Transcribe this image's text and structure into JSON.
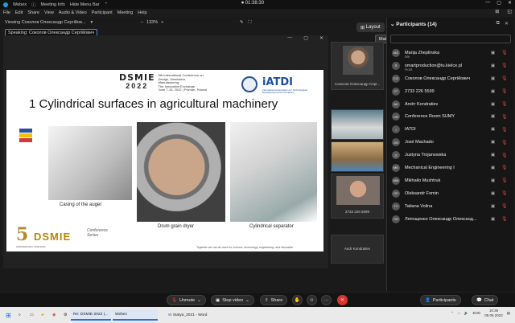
{
  "titlebar": {
    "app": "Webex",
    "meeting_info": "Meeting Info",
    "hide_menu": "Hide Menu Bar",
    "hide_arrow": "⌃",
    "timer": "01:38:30",
    "minimize": "—",
    "restore": "▢",
    "close": "✕"
  },
  "menu": [
    "File",
    "Edit",
    "Share",
    "View",
    "Audio & Video",
    "Participant",
    "Meeting",
    "Help"
  ],
  "viewbar": {
    "viewing": "Viewing Соколов Олександр Сергійов...",
    "zoom_minus": "–",
    "zoom": "133%",
    "zoom_plus": "+"
  },
  "speaking": "Speaking: Соколов Олександр Сергійович",
  "slide": {
    "dsmie": "DSMIE",
    "year": "2022",
    "conf_lines": [
      "5th International Conference on",
      "Design, Simulation, Manufacturing:",
      "The Innovation Exchange",
      "June 7-10, 2022 | Poznan, Poland"
    ],
    "iatdi": "iATDI",
    "iatdi_sub": "International Association for Technological Development and Innovations",
    "title": "1 Cylindrical surfaces in agricultural machinery",
    "caption1": "Casing of the auger",
    "caption2": "Drum grain dryer",
    "caption3": "Cylindrical separator",
    "fifth": "5",
    "footer_logo": "DSMIE",
    "series": [
      "Conference",
      "Series"
    ],
    "anniversary": "ANNIVERSARY 2018-2022",
    "tagline": "Together we can do more for science, technology, engineering, and education"
  },
  "layout_label": "Layout",
  "tooltip": "Make me presenter",
  "thumbs": [
    {
      "name": "Соколов Олександр Серг..."
    },
    {
      "name": ""
    },
    {
      "name": ""
    },
    {
      "name": "2733 226 5599"
    },
    {
      "name": "Andr Kondratiev"
    }
  ],
  "panel": {
    "title": "Participants (14)",
    "popout": "⧉",
    "close": "✕"
  },
  "participants": [
    {
      "name": "Marija Zheplinska",
      "sub": "Me",
      "init": "MZ"
    },
    {
      "name": "smartproduction@tu.kielce.pl",
      "sub": "Host",
      "init": "S"
    },
    {
      "name": "Соколов Олександр Сергійович",
      "sub": "",
      "init": "СО"
    },
    {
      "name": "2733 226 5599",
      "sub": "",
      "init": "27"
    },
    {
      "name": "Andrr Kondratiev",
      "sub": "",
      "init": "AK"
    },
    {
      "name": "Conference Room SUMY",
      "sub": "",
      "init": "CR"
    },
    {
      "name": "IATDI",
      "sub": "",
      "init": "I"
    },
    {
      "name": "José Machado",
      "sub": "",
      "init": "JM"
    },
    {
      "name": "Justyna Trojanowska",
      "sub": "",
      "init": "JT"
    },
    {
      "name": "Mechanical Engineering I",
      "sub": "",
      "init": "ME"
    },
    {
      "name": "Mikhailo Mushtruk",
      "sub": "",
      "init": "MM"
    },
    {
      "name": "Oleksandr Fomin",
      "sub": "",
      "init": "OF"
    },
    {
      "name": "Tatiana Volina",
      "sub": "",
      "init": "TV"
    },
    {
      "name": "Ляпощенко Олександр Олександ...",
      "sub": "",
      "init": "ЛО"
    }
  ],
  "controls": {
    "unmute": "Unmute",
    "stop_video": "Stop video",
    "share": "Share",
    "participants": "Participants",
    "chat": "Chat",
    "more": "···"
  },
  "taskbar": {
    "item1": "Re: DSMIE-2022 |...",
    "item2": "Webex",
    "item3": "Statya_2021 - Word",
    "lang": "ENG",
    "time": "10:36",
    "date": "09.06.2022"
  },
  "colors": {
    "accent": "#2a6fd6",
    "mute": "#e04545",
    "endcall": "#d93434",
    "brand_gold": "#b8860b",
    "iatdi_blue": "#1b4ea3"
  }
}
